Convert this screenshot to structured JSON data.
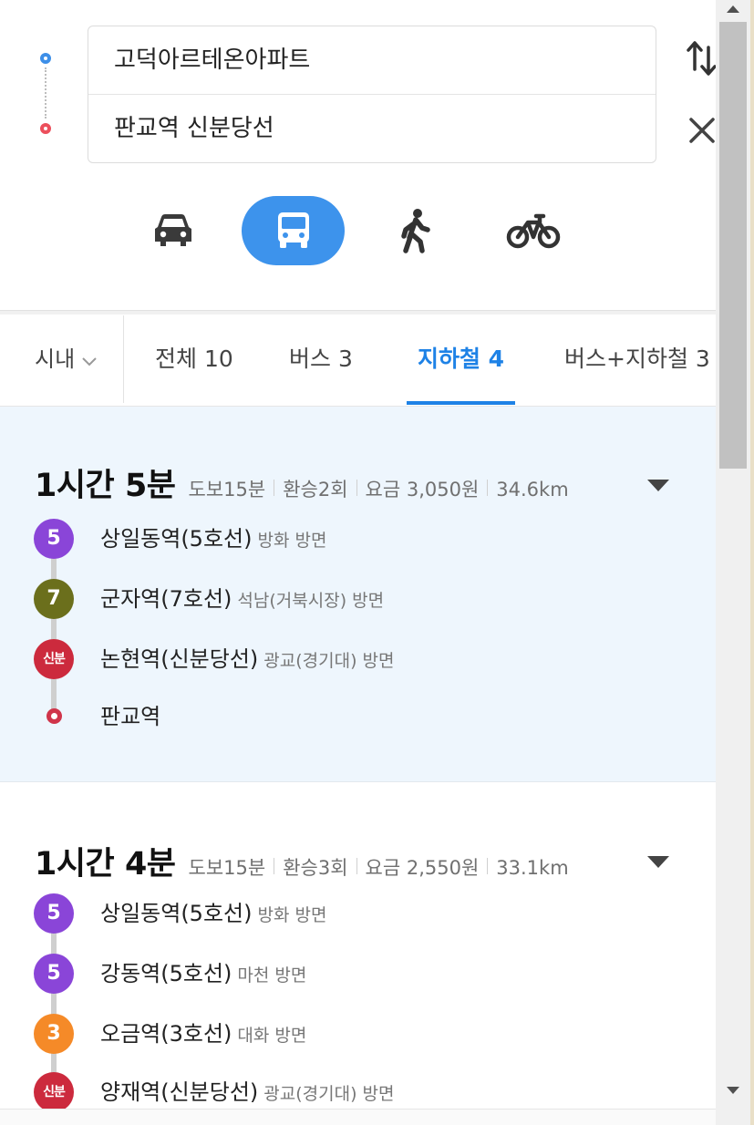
{
  "search": {
    "origin": "고덕아르테온아파트",
    "destination": "판교역 신분당선"
  },
  "modes": {
    "icons": [
      "car-icon",
      "bus-icon",
      "walk-icon",
      "bike-icon"
    ],
    "active": "transit",
    "accent": "#3d93ec"
  },
  "filters": {
    "region": "시내",
    "tabs": [
      {
        "label": "전체 10",
        "active": false
      },
      {
        "label": "버스 3",
        "active": false
      },
      {
        "label": "지하철 4",
        "active": true
      },
      {
        "label": "버스+지하철 3",
        "active": false
      }
    ],
    "active_color": "#1e82e6"
  },
  "routes": [
    {
      "duration": "1시간 5분",
      "walk": "도보15분",
      "transfers": "환승2회",
      "fare": "요금 3,050원",
      "distance": "34.6km",
      "selected": true,
      "steps": [
        {
          "badge": "5",
          "color": "#8a45d8",
          "station": "상일동역(5호선)",
          "direction": "방화 방면"
        },
        {
          "badge": "7",
          "color": "#6b6f1c",
          "station": "군자역(7호선)",
          "direction": "석남(거북시장) 방면"
        },
        {
          "badge": "신분",
          "color": "#cc2a3d",
          "station": "논현역(신분당선)",
          "direction": "광교(경기대) 방면"
        },
        {
          "badge": "",
          "color": "#d0344a",
          "station": "판교역",
          "direction": ""
        }
      ]
    },
    {
      "duration": "1시간 4분",
      "walk": "도보15분",
      "transfers": "환승3회",
      "fare": "요금 2,550원",
      "distance": "33.1km",
      "selected": false,
      "steps": [
        {
          "badge": "5",
          "color": "#8a45d8",
          "station": "상일동역(5호선)",
          "direction": "방화 방면"
        },
        {
          "badge": "5",
          "color": "#8a45d8",
          "station": "강동역(5호선)",
          "direction": "마천 방면"
        },
        {
          "badge": "3",
          "color": "#f58a28",
          "station": "오금역(3호선)",
          "direction": "대화 방면"
        },
        {
          "badge": "신분",
          "color": "#cc2a3d",
          "station": "양재역(신분당선)",
          "direction": "광교(경기대) 방면"
        }
      ]
    }
  ]
}
